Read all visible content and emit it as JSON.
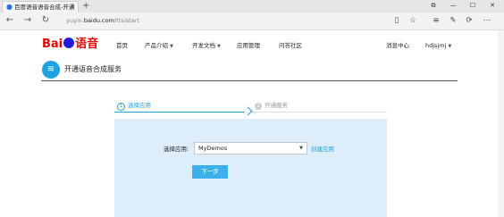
{
  "browser": {
    "tab_title": "百度语音语音合成-开通",
    "new_tab": "+",
    "url_prefix": "yuyin.",
    "url_domain": "baidu.com",
    "url_path": "/tts/start",
    "window_buttons": [
      "⧉",
      "—",
      "☐",
      "✕"
    ],
    "back": "←",
    "forward": "→",
    "refresh": "↻",
    "toolbar_icons": [
      "read-view-icon",
      "favorites-star-icon",
      "hub-icon",
      "notes-icon",
      "share-icon",
      "more-icon"
    ]
  },
  "logo": {
    "bai": "Bai",
    "du": "",
    "yuyin": "语音"
  },
  "nav": {
    "items": [
      "首页",
      "产品介绍",
      "开发文档",
      "应用管理",
      "问答社区"
    ],
    "right": [
      "消息中心",
      "hdjsjmj"
    ]
  },
  "service_title": "开通语音合成服务",
  "steps": [
    {
      "num": "1",
      "label": "选择应用"
    },
    {
      "num": "2",
      "label": "开通服务"
    }
  ],
  "form": {
    "label": "选择应用:",
    "selected": "MyDemos",
    "create_link": "创建应用",
    "next_button": "下一步"
  },
  "colors": {
    "accent": "#1fa2e0",
    "panel_bg": "#ddeefa",
    "baidu_red": "#e10602"
  }
}
